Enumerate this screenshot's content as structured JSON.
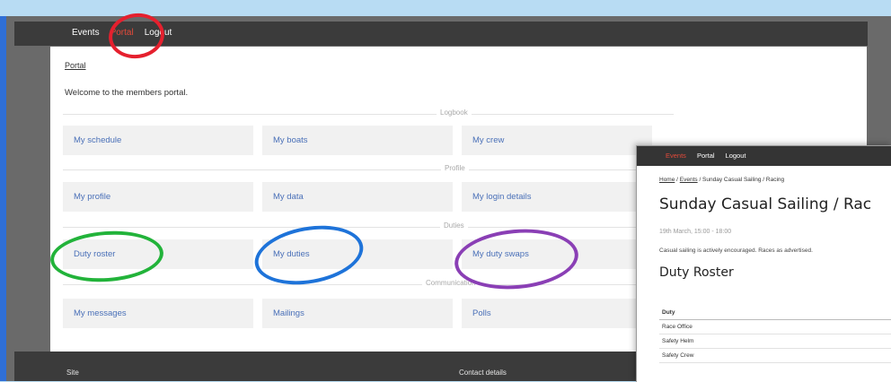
{
  "nav": {
    "events": "Events",
    "portal": "Portal",
    "logout": "Logout"
  },
  "portal": {
    "breadcrumb": "Portal",
    "welcome": "Welcome to the members portal.",
    "sections": {
      "logbook": "Logbook",
      "profile": "Profile",
      "duties": "Duties",
      "communication": "Communication"
    },
    "cards": {
      "my_schedule": "My schedule",
      "my_boats": "My boats",
      "my_crew": "My crew",
      "my_profile": "My profile",
      "my_data": "My data",
      "my_login_details": "My login details",
      "duty_roster": "Duty roster",
      "my_duties": "My duties",
      "my_duty_swaps": "My duty swaps",
      "my_messages": "My messages",
      "mailings": "Mailings",
      "polls": "Polls"
    }
  },
  "footer": {
    "site": "Site",
    "contact": "Contact details"
  },
  "annotations": {
    "portal_circle": "#e5202e",
    "duty_roster_circle": "#22b33a",
    "my_duties_circle": "#1e73d9",
    "my_duty_swaps_circle": "#8a3fb5"
  },
  "overlay": {
    "nav": {
      "events": "Events",
      "portal": "Portal",
      "logout": "Logout"
    },
    "breadcrumb": {
      "home": "Home",
      "events": "Events",
      "rest": " / Sunday Casual Sailing / Racing"
    },
    "title": "Sunday Casual Sailing / Rac",
    "date": "19th March, 15:00 - 18:00",
    "description": "Casual sailing is actively encouraged. Races as advertised.",
    "duty_roster_heading": "Duty Roster",
    "table": {
      "header": "Duty",
      "rows": [
        "Race Office",
        "Safety Helm",
        "Safety Crew"
      ]
    }
  }
}
